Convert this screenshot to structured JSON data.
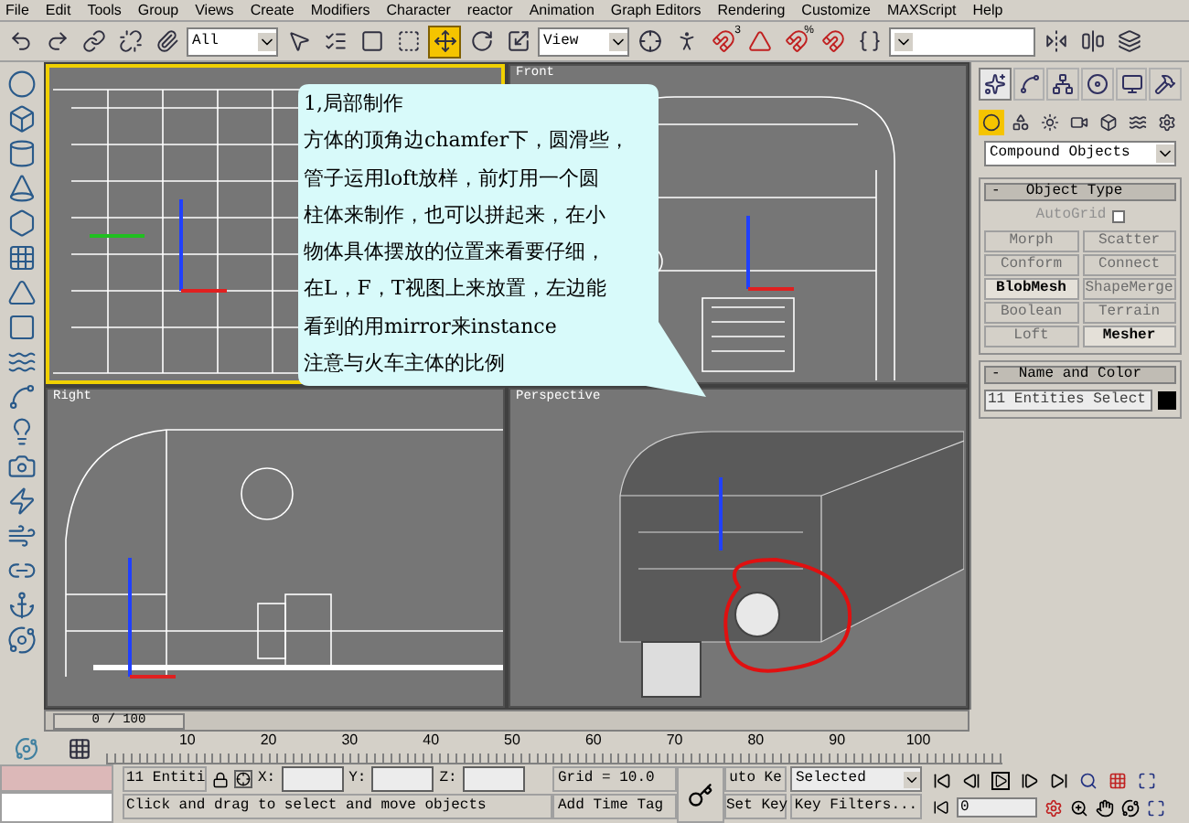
{
  "menu": [
    "File",
    "Edit",
    "Tools",
    "Group",
    "Views",
    "Create",
    "Modifiers",
    "Character",
    "reactor",
    "Animation",
    "Graph Editors",
    "Rendering",
    "Customize",
    "MAXScript",
    "Help"
  ],
  "toolbar": [
    {
      "kind": "undo",
      "selected": false
    },
    {
      "kind": "redo",
      "selected": false
    },
    {
      "kind": "link",
      "selected": false
    },
    {
      "kind": "unlink",
      "selected": false
    },
    {
      "kind": "bind",
      "selected": false
    },
    {
      "kind": "dropdown",
      "value": "All"
    },
    {
      "kind": "select",
      "selected": false
    },
    {
      "kind": "select_by_name",
      "selected": false
    },
    {
      "kind": "region",
      "selected": false
    },
    {
      "kind": "crossing",
      "selected": false
    },
    {
      "kind": "move",
      "selected": true
    },
    {
      "kind": "rotate",
      "selected": false
    },
    {
      "kind": "scale",
      "selected": false
    },
    {
      "kind": "dropdown",
      "value": "View"
    },
    {
      "kind": "pivot",
      "selected": false
    },
    {
      "kind": "manipulate",
      "selected": false
    },
    {
      "kind": "snap",
      "selected": false,
      "badge": "3"
    },
    {
      "kind": "angle_snap",
      "selected": false
    },
    {
      "kind": "snap",
      "selected": false,
      "badge": "%"
    },
    {
      "kind": "spinner_snap",
      "selected": false
    },
    {
      "kind": "named_selection",
      "selected": false
    },
    {
      "kind": "dropdown"
    },
    {
      "kind": "mirror",
      "selected": false
    },
    {
      "kind": "align",
      "selected": false
    },
    {
      "kind": "layers",
      "selected": false
    }
  ],
  "viewports": [
    {
      "active": true
    },
    {
      "label": "Front",
      "active": false
    },
    {
      "label": "Right",
      "active": false
    },
    {
      "label": "Perspective",
      "active": false
    }
  ],
  "callout": {
    "lines": [
      "1,局部制作",
      "方体的顶角边chamfer下，圆滑些，",
      "管子运用loft放样，前灯用一个圆",
      "柱体来制作，也可以拼起来，在小",
      "物体具体摆放的位置来看要仔细，",
      "在L，F，T视图上来放置，左边能",
      "看到的用mirror来instance",
      "注意与火车主体的比例"
    ]
  },
  "command_panel": {
    "tabs": [
      {
        "kind": "create",
        "selected": true
      },
      {
        "kind": "modify",
        "selected": false
      },
      {
        "kind": "hierarchy",
        "selected": false
      },
      {
        "kind": "motion",
        "selected": false
      },
      {
        "kind": "display",
        "selected": false
      },
      {
        "kind": "utilities",
        "selected": false
      }
    ],
    "categories": [
      {
        "kind": "geometry",
        "selected": true
      },
      {
        "kind": "shapes",
        "selected": false
      },
      {
        "kind": "lights",
        "selected": false
      },
      {
        "kind": "cameras",
        "selected": false
      },
      {
        "kind": "helpers",
        "selected": false
      },
      {
        "kind": "space_warps",
        "selected": false
      },
      {
        "kind": "systems",
        "selected": false
      }
    ],
    "dropdown": "Compound Objects",
    "object_type": {
      "toggle": "-",
      "title": "Object Type",
      "autogrid": {
        "label": "AutoGrid",
        "checked": false
      },
      "buttons": [
        {
          "label": "Morph",
          "disabled": true
        },
        {
          "label": "Scatter",
          "disabled": true
        },
        {
          "label": "Conform",
          "disabled": true
        },
        {
          "label": "Connect",
          "disabled": true
        },
        {
          "label": "BlobMesh",
          "disabled": false
        },
        {
          "label": "ShapeMerge",
          "disabled": true
        },
        {
          "label": "Boolean",
          "disabled": true
        },
        {
          "label": "Terrain",
          "disabled": true
        },
        {
          "label": "Loft",
          "disabled": true
        },
        {
          "label": "Mesher",
          "disabled": false
        }
      ]
    },
    "name_and_color": {
      "toggle": "-",
      "title": "Name and Color",
      "name": "11 Entities Select"
    }
  },
  "time_slider": "0 / 100",
  "trackbar_ticks": [
    "10",
    "20",
    "30",
    "40",
    "50",
    "60",
    "70",
    "80",
    "90",
    "100"
  ],
  "status": {
    "selection": "11 Entiti",
    "x_label": "X:",
    "y_label": "Y:",
    "z_label": "Z:",
    "grid": "Grid = 10.0",
    "prompt": "Click and drag to select and move objects",
    "add_time_tag": "Add Time Tag",
    "auto_key": "uto Ke",
    "set_key": "Set Key",
    "key_mode": "Selected",
    "key_filters": "Key Filters...",
    "frame": "0"
  }
}
